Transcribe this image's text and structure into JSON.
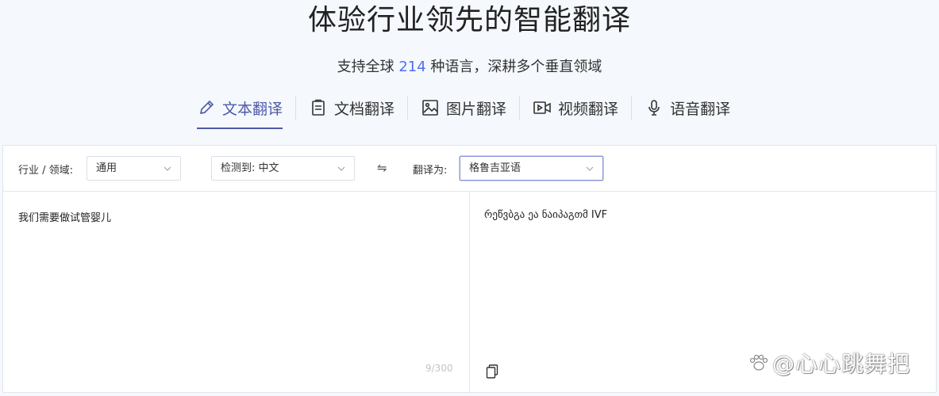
{
  "hero": {
    "title": "体验行业领先的智能翻译",
    "subtitle_prefix": "支持全球 ",
    "subtitle_count": "214",
    "subtitle_suffix": " 种语言，深耕多个垂直领域"
  },
  "tabs": [
    {
      "label": "文本翻译",
      "icon": "pencil-icon",
      "active": true
    },
    {
      "label": "文档翻译",
      "icon": "document-icon",
      "active": false
    },
    {
      "label": "图片翻译",
      "icon": "image-icon",
      "active": false
    },
    {
      "label": "视频翻译",
      "icon": "video-icon",
      "active": false
    },
    {
      "label": "语音翻译",
      "icon": "microphone-icon",
      "active": false
    }
  ],
  "toolbar": {
    "domain_label": "行业 / 领域:",
    "domain_value": "通用",
    "detect_value": "检测到: 中文",
    "swap_icon": "⇋",
    "target_label": "翻译为:",
    "target_value": "格鲁吉亚语"
  },
  "source": {
    "text": "我们需要做试管婴儿",
    "counter": "9/300"
  },
  "result": {
    "text": "რეწვბგა ეა ნაიპაგთმ IVF"
  },
  "watermark": {
    "text": "@心心跳舞把"
  },
  "colors": {
    "accent": "#4e5aa8",
    "count_blue": "#4e6ef2",
    "background": "#f5f8fd"
  }
}
